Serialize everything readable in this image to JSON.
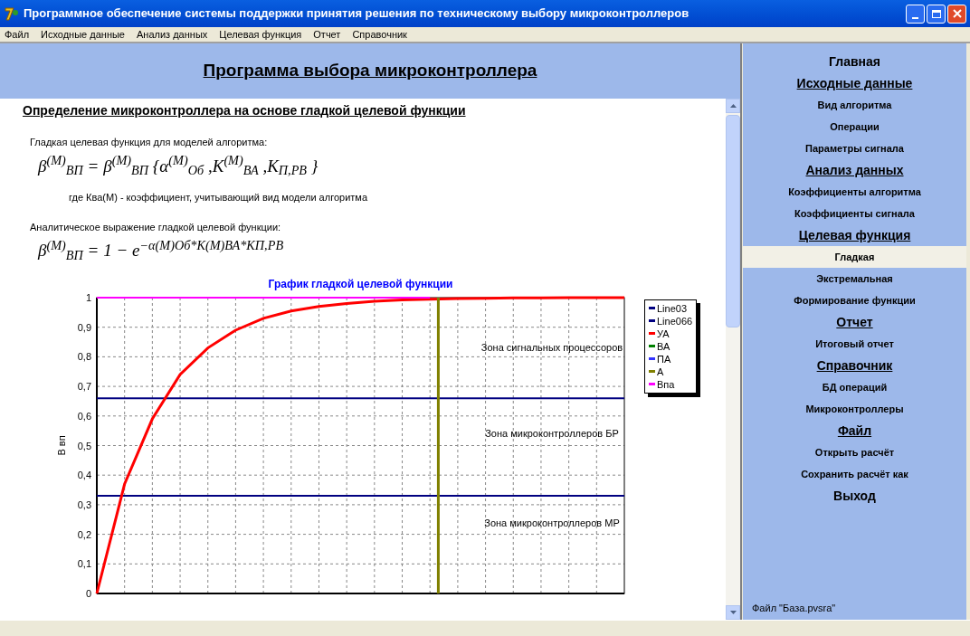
{
  "window": {
    "title": "Программное обеспечение системы поддержки принятия решения по техническому выбору микроконтроллеров"
  },
  "menu": [
    "Файл",
    "Исходные данные",
    "Анализ данных",
    "Целевая функция",
    "Отчет",
    "Справочник"
  ],
  "header": {
    "title": "Программа выбора микроконтроллера"
  },
  "content": {
    "heading": "Определение микроконтроллера  на основе гладкой целевой функции",
    "blocks": [
      {
        "kind": "text",
        "text": "Гладкая целевая функция для моделей алгоритма:"
      },
      {
        "kind": "formula",
        "text": "β$^{(M)}$$_{ВП}$ = β$^{(M)}$$_{ВП}$ {α$^{(M)}$$_{Об}$ ,K$^{(M)}$$_{ВА}$ ,K$_{П,РВ}$ }"
      },
      {
        "kind": "note",
        "text": "где Ква(М) - коэффициент, учитывающий вид модели алгоритма"
      },
      {
        "kind": "text",
        "text": "Аналитическое выражение гладкой целевой функции:"
      },
      {
        "kind": "formula",
        "text": "β$^{(M)}$$_{ВП}$ = 1 − e$^{−α(M)Об*K(M)ВА*KП,РВ}$"
      }
    ]
  },
  "chart": {
    "zones": [
      "Зона сигнальных процессоров",
      "Зона микроконтроллеров БР",
      "Зона микроконтроллеров МР"
    ],
    "chart_data": {
      "type": "line",
      "title": "График гладкой целевой функции",
      "ylabel": "В вп",
      "grid": true,
      "legend": true,
      "ylim": [
        0,
        1
      ],
      "yticks": [
        {
          "value": 0,
          "label": "0"
        },
        {
          "value": 0.1,
          "label": "0,1"
        },
        {
          "value": 0.2,
          "label": "0,2"
        },
        {
          "value": 0.3,
          "label": "0,3"
        },
        {
          "value": 0.4,
          "label": "0,4"
        },
        {
          "value": 0.5,
          "label": "0,5"
        },
        {
          "value": 0.6,
          "label": "0,6"
        },
        {
          "value": 0.7,
          "label": "0,7"
        },
        {
          "value": 0.8,
          "label": "0,8"
        },
        {
          "value": 0.9,
          "label": "0,9"
        },
        {
          "value": 1,
          "label": "1"
        }
      ],
      "series": [
        {
          "name": "Line03",
          "color": "#000080",
          "values": [
            0.33,
            0.33,
            0.33,
            0.33,
            0.33,
            0.33,
            0.33,
            0.33,
            0.33,
            0.33,
            0.33,
            0.33,
            0.33,
            0.33,
            0.33,
            0.33,
            0.33,
            0.33,
            0.33,
            0.33
          ]
        },
        {
          "name": "Line066",
          "color": "#000080",
          "values": [
            0.66,
            0.66,
            0.66,
            0.66,
            0.66,
            0.66,
            0.66,
            0.66,
            0.66,
            0.66,
            0.66,
            0.66,
            0.66,
            0.66,
            0.66,
            0.66,
            0.66,
            0.66,
            0.66,
            0.66
          ]
        },
        {
          "name": "УА",
          "color": "#ff0000",
          "values": [
            0,
            0.37,
            0.59,
            0.74,
            0.83,
            0.89,
            0.93,
            0.955,
            0.97,
            0.98,
            0.988,
            0.992,
            0.995,
            0.997,
            0.998,
            0.999,
            0.999,
            1,
            1,
            1
          ]
        },
        {
          "name": "ВА",
          "color": "#008000",
          "values": [
            null,
            null,
            null,
            null,
            null,
            null,
            null,
            null,
            null,
            null,
            null,
            null,
            null,
            null,
            null,
            null,
            null,
            null,
            null,
            null
          ]
        },
        {
          "name": "ПА",
          "color": "#3333ff",
          "values": [
            null,
            null,
            null,
            null,
            null,
            null,
            null,
            null,
            null,
            null,
            null,
            null,
            null,
            null,
            null,
            null,
            null,
            null,
            null,
            null
          ]
        },
        {
          "name": "А",
          "color": "#808000",
          "values": [
            null,
            null,
            null,
            null,
            null,
            null,
            null,
            null,
            null,
            null,
            null,
            null,
            null,
            null,
            null,
            null,
            null,
            null,
            null,
            null
          ]
        },
        {
          "name": "Впа",
          "color": "#ff00ff",
          "values": [
            1,
            1,
            1,
            1,
            1,
            1,
            1,
            1,
            1,
            1,
            1,
            1,
            1,
            null,
            null,
            null,
            null,
            null,
            null,
            null
          ]
        }
      ]
    }
  },
  "sidebar": {
    "items": [
      {
        "kind": "link",
        "label": "Главная",
        "selected": false,
        "large": true
      },
      {
        "kind": "heading",
        "label": "Исходные данные"
      },
      {
        "kind": "link",
        "label": "Вид алгоритма",
        "selected": false,
        "large": false
      },
      {
        "kind": "link",
        "label": "Операции",
        "selected": false,
        "large": false
      },
      {
        "kind": "link",
        "label": "Параметры сигнала",
        "selected": false,
        "large": false
      },
      {
        "kind": "heading",
        "label": "Анализ данных"
      },
      {
        "kind": "link",
        "label": "Коэффициенты алгоритма",
        "selected": false,
        "large": false
      },
      {
        "kind": "link",
        "label": "Коэффициенты сигнала",
        "selected": false,
        "large": false
      },
      {
        "kind": "heading",
        "label": "Целевая функция"
      },
      {
        "kind": "link",
        "label": "Гладкая",
        "selected": true,
        "large": false
      },
      {
        "kind": "link",
        "label": "Экстремальная",
        "selected": false,
        "large": false
      },
      {
        "kind": "link",
        "label": "Формирование функции",
        "selected": false,
        "large": false
      },
      {
        "kind": "heading",
        "label": "Отчет"
      },
      {
        "kind": "link",
        "label": "Итоговый отчет",
        "selected": false,
        "large": false
      },
      {
        "kind": "heading",
        "label": "Справочник"
      },
      {
        "kind": "link",
        "label": "БД операций",
        "selected": false,
        "large": false
      },
      {
        "kind": "link",
        "label": "Микроконтроллеры",
        "selected": false,
        "large": false
      },
      {
        "kind": "heading",
        "label": "Файл"
      },
      {
        "kind": "link",
        "label": "Открыть расчёт",
        "selected": false,
        "large": false
      },
      {
        "kind": "link",
        "label": "Сохранить расчёт как",
        "selected": false,
        "large": false
      },
      {
        "kind": "link",
        "label": "Выход",
        "selected": false,
        "large": true
      }
    ],
    "file_label": "Файл \"База.pvsra\""
  }
}
